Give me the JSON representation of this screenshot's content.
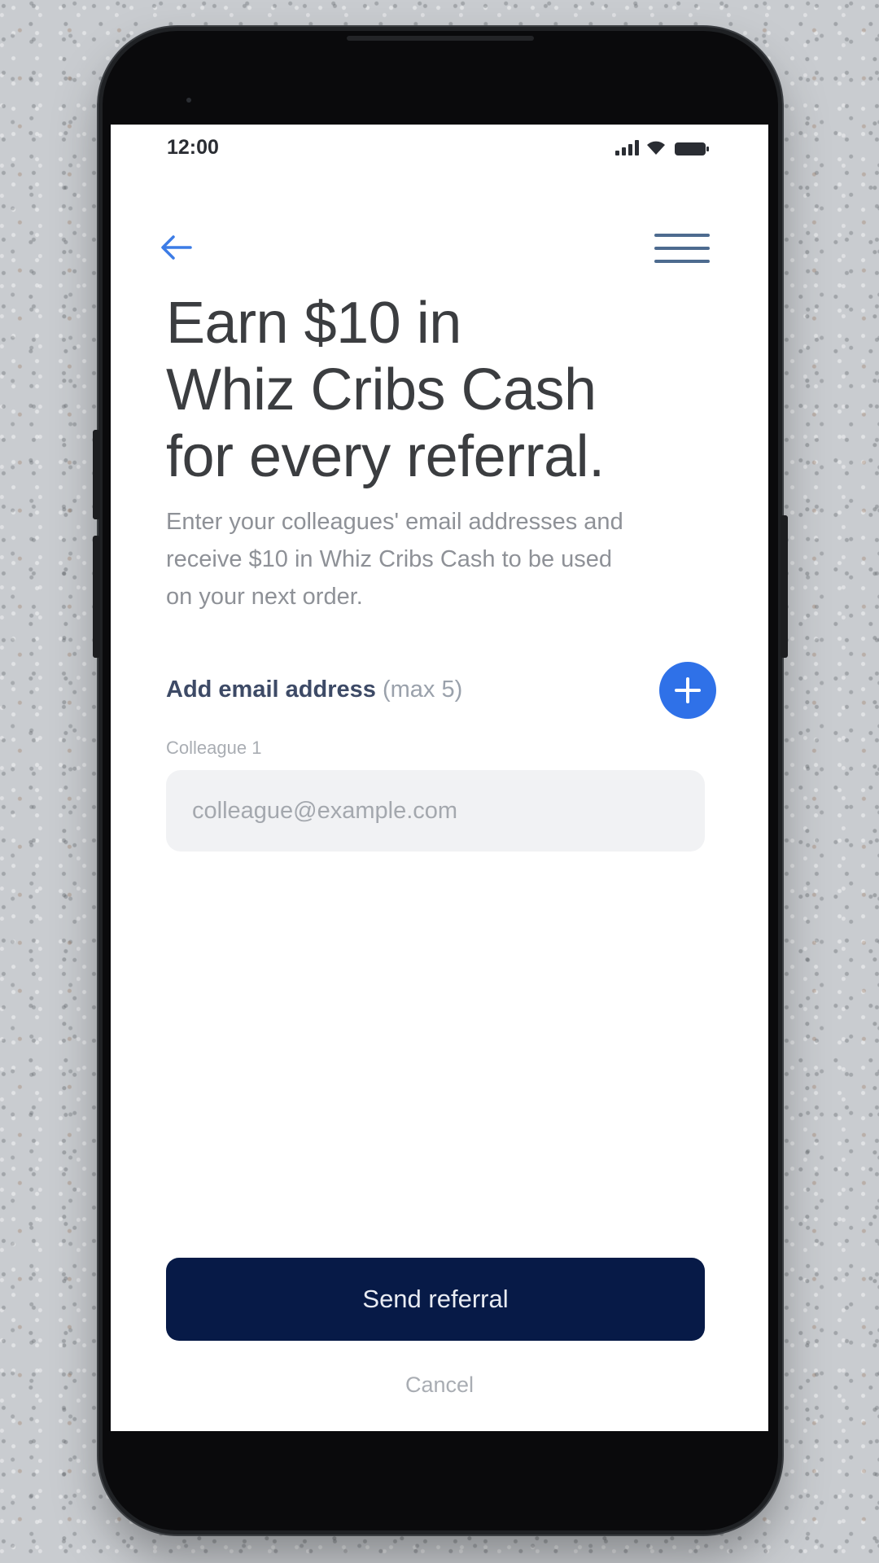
{
  "status_bar": {
    "time": "12:00"
  },
  "nav": {
    "back_icon": "arrow-left-icon",
    "menu_icon": "hamburger-menu-icon"
  },
  "content": {
    "headline_line1": "Earn $10 in",
    "headline_line2": "Whiz Cribs Cash",
    "headline_line3": "for every referral.",
    "description_line1": "Enter your colleagues' email addresses and",
    "description_line2": "receive $10 in Whiz Cribs Cash to be used",
    "description_line3": "on your next order."
  },
  "add_email": {
    "label": "Add email address",
    "limit": "(max 5)",
    "add_icon": "plus-icon"
  },
  "colleagues": [
    {
      "label": "Colleague 1",
      "placeholder": "colleague@example.com",
      "value": ""
    }
  ],
  "actions": {
    "send_label": "Send referral",
    "cancel_label": "Cancel"
  },
  "colors": {
    "primary_button": "#071a47",
    "accent_blue": "#2f71e8",
    "background": "#ffffff"
  }
}
